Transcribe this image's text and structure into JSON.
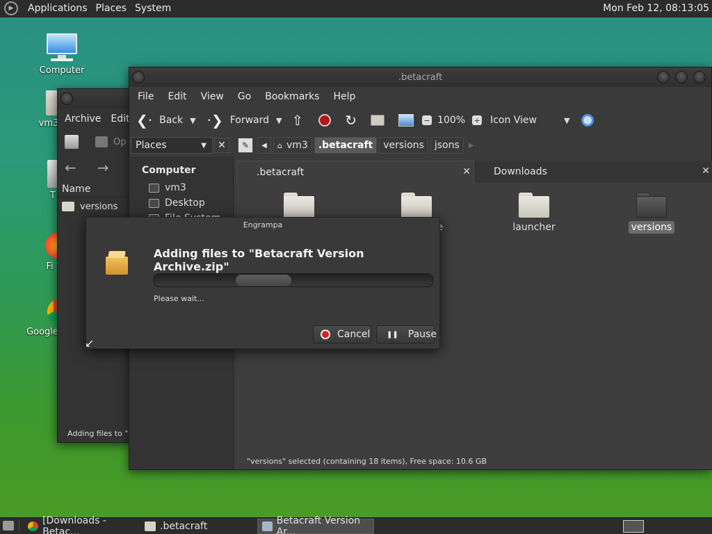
{
  "top_panel": {
    "menus": [
      "Applications",
      "Places",
      "System"
    ],
    "clock": "Mon Feb 12, 08:13:05"
  },
  "desktop_icons": [
    {
      "label": "Computer",
      "icon": "computer-icon"
    },
    {
      "label": "vm3",
      "icon": "home-folder-icon"
    },
    {
      "label": "T",
      "icon": "trash-icon"
    },
    {
      "label": "Fi",
      "icon": "firefox-icon"
    },
    {
      "label": "Google",
      "icon": "chrome-icon"
    }
  ],
  "archive_window": {
    "menus": [
      "Archive",
      "Edit"
    ],
    "open_label": "Op",
    "column_name": "Name",
    "row_label": "versions",
    "status": "Adding files to \"Be"
  },
  "caja_window": {
    "title": ".betacraft",
    "menus": [
      "File",
      "Edit",
      "View",
      "Go",
      "Bookmarks",
      "Help"
    ],
    "toolbar": {
      "back": "Back",
      "forward": "Forward",
      "zoom": "100%",
      "view_mode": "Icon View"
    },
    "sidebar_selector": "Places",
    "breadcrumbs": [
      "vm3",
      ".betacraft",
      "versions",
      "jsons"
    ],
    "active_crumb": ".betacraft",
    "sidebar": {
      "heading": "Computer",
      "items": [
        "vm3",
        "Desktop",
        "File System"
      ]
    },
    "tabs": [
      ".betacraft",
      "Downloads"
    ],
    "folders": [
      {
        "label": "",
        "style": "light"
      },
      {
        "label": "ce",
        "style": "light"
      },
      {
        "label": "launcher",
        "style": "light"
      },
      {
        "label": "versions",
        "style": "dark",
        "selected": true
      }
    ],
    "status": "\"versions\" selected (containing 18 items), Free space: 10.6 GB"
  },
  "dialog": {
    "title": "Engrampa",
    "heading": "Adding files to \"Betacraft Version Archive.zip\"",
    "message": "Please wait...",
    "cancel": "Cancel",
    "pause": "Pause"
  },
  "taskbar": {
    "tasks": [
      "[Downloads - Betac...",
      ".betacraft",
      "Betacraft Version Ar..."
    ],
    "active_index": 2
  },
  "colors": {
    "panel": "#2c2c2c",
    "window": "#3a3a3a",
    "cancel_red": "#d42020"
  }
}
